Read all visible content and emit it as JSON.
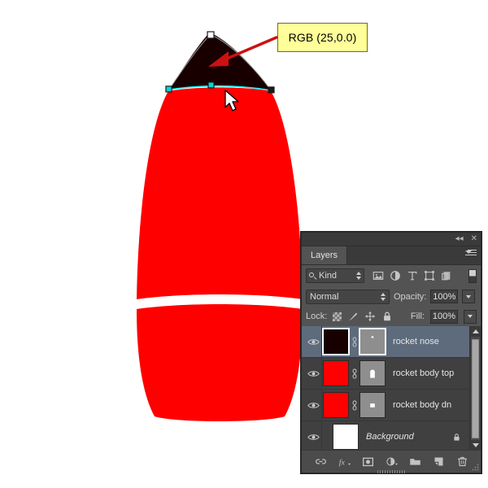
{
  "canvas": {
    "background_color": "#ffffff",
    "artwork_name": "rocket-illustration",
    "nose_color": "#190000",
    "body_color": "#ff0000",
    "path_stroke_color": "#00e5e5",
    "anchor_fill": "#00d8d8"
  },
  "annotation": {
    "callout_text": "RGB (25,0.0)",
    "callout_bg": "#ffff99",
    "callout_border": "#6b6b2e",
    "arrow_color": "#cc1111"
  },
  "panel": {
    "titlebar": {
      "collapse_label": "◂◂",
      "close_label": "✕"
    },
    "tabs": [
      {
        "label": "Layers",
        "active": true
      }
    ],
    "filter": {
      "search_icon": "search-icon",
      "kind_label": "Kind",
      "icons": [
        "pixel-layer-filter-icon",
        "adjustment-layer-filter-icon",
        "type-layer-filter-icon",
        "shape-layer-filter-icon",
        "smart-object-filter-icon"
      ],
      "toggle_name": "filter-enable-toggle"
    },
    "blend": {
      "mode": "Normal",
      "opacity_label": "Opacity:",
      "opacity_value": "100%"
    },
    "lock": {
      "label": "Lock:",
      "icons": [
        "lock-transparent-pixels-icon",
        "lock-image-pixels-icon",
        "lock-position-icon",
        "lock-all-icon"
      ],
      "fill_label": "Fill:",
      "fill_value": "100%"
    },
    "layers": [
      {
        "name": "rocket nose",
        "visible": true,
        "selected": true,
        "thumb_color": "#190000",
        "mask": "rocket-nose-mask",
        "linked": true,
        "locked": false,
        "italic": false
      },
      {
        "name": "rocket body top",
        "visible": true,
        "selected": false,
        "thumb_color": "#ff0000",
        "mask": "rocket-body-top-mask",
        "linked": true,
        "locked": false,
        "italic": false
      },
      {
        "name": "rocket body dn",
        "visible": true,
        "selected": false,
        "thumb_color": "#ff0000",
        "mask": "rocket-body-dn-mask",
        "linked": true,
        "locked": false,
        "italic": false
      },
      {
        "name": "Background",
        "visible": true,
        "selected": false,
        "thumb_color": "#ffffff",
        "mask": null,
        "linked": false,
        "locked": true,
        "italic": true
      }
    ],
    "footer_icons": [
      "link-layers-icon",
      "layer-style-fx-icon",
      "add-layer-mask-icon",
      "new-adjustment-layer-icon",
      "new-group-icon",
      "new-layer-icon",
      "delete-layer-icon"
    ]
  }
}
